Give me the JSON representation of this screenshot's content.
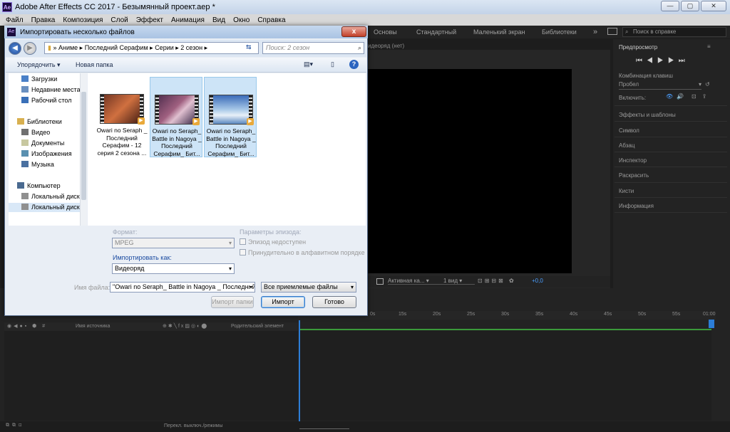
{
  "window": {
    "title": "Adobe After Effects CC 2017 - Безымянный проект.aep *",
    "logo": "Ae",
    "minimize": "—",
    "maximize": "▢",
    "close": "✕"
  },
  "menu": [
    "Файл",
    "Правка",
    "Композиция",
    "Слой",
    "Эффект",
    "Анимация",
    "Вид",
    "Окно",
    "Справка"
  ],
  "workspaces": {
    "items": [
      "Основы",
      "Стандартный",
      "Маленький экран",
      "Библиотеки"
    ],
    "more": "»",
    "help_search": "Поиск в справке"
  },
  "viewer": {
    "header": "идеоряд (нет)",
    "zoom_label": "Активная ка...",
    "views": "1 вид",
    "exposure": "+0,0"
  },
  "right_panel": {
    "preview": "Предпросмотр",
    "shortcut_label": "Комбинация клавиш",
    "shortcut_value": "Пробел",
    "include_label": "Включить:",
    "items": [
      "Эффекты и шаблоны",
      "Символ",
      "Абзац",
      "Инспектор",
      "Раскрасить",
      "Кисти",
      "Информация"
    ]
  },
  "timeline": {
    "ticks": [
      "0s",
      "15s",
      "20s",
      "25s",
      "30s",
      "35s",
      "40s",
      "45s",
      "50s",
      "55s",
      "01:00"
    ],
    "header_source": "Имя источника",
    "header_parent": "Родительский элемент",
    "bottom_toggle": "Перекл. выключ./режимы"
  },
  "dialog": {
    "title": "Импортировать несколько файлов",
    "logo": "Ae",
    "close": "x",
    "breadcrumb": [
      "Аниме",
      "Последний Серафим",
      "Серии",
      "2 сезон"
    ],
    "search_placeholder": "Поиск: 2 сезон",
    "organize": "Упорядочить ▾",
    "new_folder": "Новая папка",
    "help": "?",
    "nav": [
      {
        "label": "Загрузки"
      },
      {
        "label": "Недавние места"
      },
      {
        "label": "Рабочий стол"
      },
      {
        "label": "Библиотеки"
      },
      {
        "label": "Видео"
      },
      {
        "label": "Документы"
      },
      {
        "label": "Изображения"
      },
      {
        "label": "Музыка"
      },
      {
        "label": "Компьютер"
      },
      {
        "label": "Локальный диск"
      },
      {
        "label": "Локальный диск"
      }
    ],
    "files": [
      {
        "name": "Owari no Seraph _ Последний Серафим - 12 серия 2 сезона ...",
        "selected": false
      },
      {
        "name": "Owari no Seraph_ Battle in Nagoya _ Последний Серафим_ Бит...",
        "selected": true
      },
      {
        "name": "Owari no Seraph_ Battle in Nagoya _ Последний Серафим_ Бит...",
        "selected": true
      }
    ],
    "format_label": "Формат:",
    "format_value": "MPEG",
    "import_as_label": "Импортировать как:",
    "import_as_value": "Видеоряд",
    "sequence_label": "Параметры эпизода:",
    "sequence_unavailable": "Эпизод недоступен",
    "force_alpha": "Принудительно в алфавитном порядке",
    "filename_label": "Имя файла:",
    "filename_value": "\"Owari no Seraph_ Battle in Nagoya _ Последний",
    "filetype_value": "Все приемлемые файлы",
    "import_folder": "Импорт папки",
    "import": "Импорт",
    "done": "Готово"
  }
}
